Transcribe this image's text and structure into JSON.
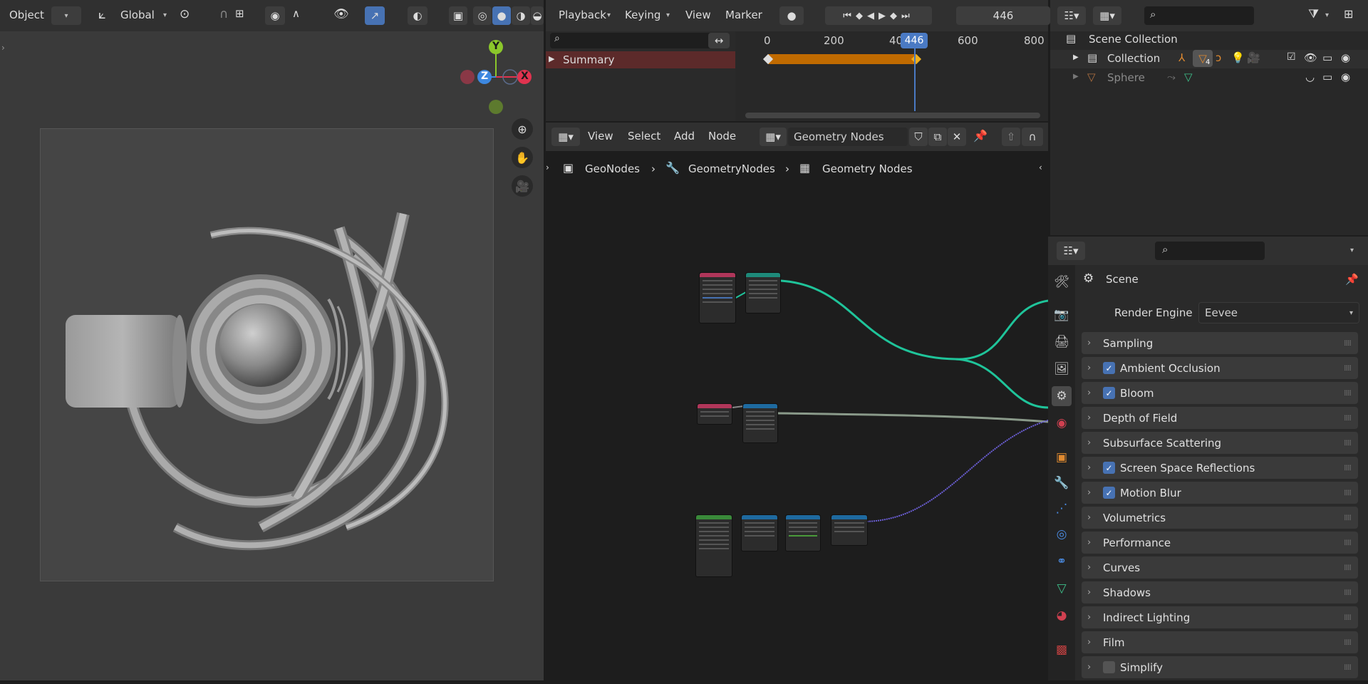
{
  "viewport": {
    "mode_label": "Object",
    "transform_orientation": "Global",
    "gizmo_axes": {
      "y": "Y",
      "z": "Z",
      "x": "X"
    }
  },
  "timeline": {
    "menus": [
      "Playback",
      "Keying",
      "View",
      "Marker"
    ],
    "current_frame": "446",
    "frame_marks": [
      "0",
      "200",
      "40",
      "600",
      "800"
    ],
    "playhead_label": "446",
    "summary_label": "Summary"
  },
  "outliner": {
    "root": "Scene Collection",
    "collection": "Collection",
    "collection_badge": "4",
    "object": "Sphere"
  },
  "node_editor": {
    "menus": [
      "View",
      "Select",
      "Add",
      "Node"
    ],
    "node_tree_name": "Geometry Nodes",
    "breadcrumb": [
      "GeoNodes",
      "GeometryNodes",
      "Geometry Nodes"
    ]
  },
  "properties": {
    "context": "Scene",
    "render_engine_label": "Render Engine",
    "render_engine_value": "Eevee",
    "panels": [
      {
        "label": "Sampling",
        "checkbox": "none"
      },
      {
        "label": "Ambient Occlusion",
        "checkbox": "on"
      },
      {
        "label": "Bloom",
        "checkbox": "on"
      },
      {
        "label": "Depth of Field",
        "checkbox": "none"
      },
      {
        "label": "Subsurface Scattering",
        "checkbox": "none"
      },
      {
        "label": "Screen Space Reflections",
        "checkbox": "on"
      },
      {
        "label": "Motion Blur",
        "checkbox": "on"
      },
      {
        "label": "Volumetrics",
        "checkbox": "none"
      },
      {
        "label": "Performance",
        "checkbox": "none"
      },
      {
        "label": "Curves",
        "checkbox": "none"
      },
      {
        "label": "Shadows",
        "checkbox": "none"
      },
      {
        "label": "Indirect Lighting",
        "checkbox": "none"
      },
      {
        "label": "Film",
        "checkbox": "none"
      },
      {
        "label": "Simplify",
        "checkbox": "off"
      }
    ]
  },
  "colors": {
    "accent": "#4772b3",
    "playhead": "#4a7ac4",
    "keyframe_bar": "#c06a00",
    "link_green": "#1fc49a",
    "link_purple": "#6b5fd6",
    "axis_x": "#e0334f",
    "axis_y": "#8bc72b",
    "axis_z": "#3d88e0"
  }
}
